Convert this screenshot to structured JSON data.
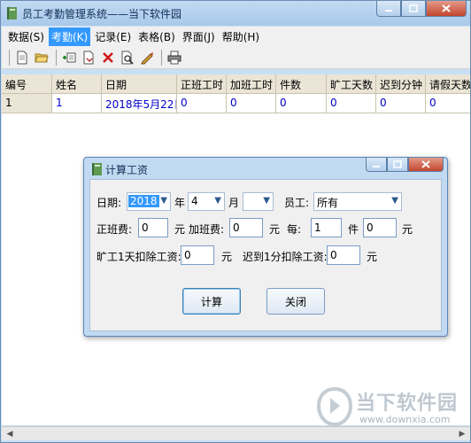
{
  "window": {
    "title": "员工考勤管理系统——当下软件园"
  },
  "menubar": {
    "items": [
      "数据(S)",
      "考勤(K)",
      "记录(E)",
      "表格(B)",
      "界面(J)",
      "帮助(H)"
    ],
    "active_index": 1
  },
  "toolbar": {
    "buttons": [
      "new-icon",
      "open-folder-icon",
      "add-record-icon",
      "export-icon",
      "delete-icon",
      "preview-icon",
      "edit-pencil-icon",
      "print-icon"
    ]
  },
  "grid": {
    "columns": [
      "编号",
      "姓名",
      "日期",
      "正班工时",
      "加班工时",
      "件数",
      "旷工天数",
      "迟到分钟",
      "请假天数"
    ],
    "rows": [
      [
        "1",
        "1",
        "2018年5月22日",
        "0",
        "0",
        "0",
        "0",
        "0",
        "0"
      ]
    ]
  },
  "dialog": {
    "title": "计算工资",
    "date_label": "日期:",
    "year_value": "2018",
    "year_unit": "年",
    "month_value": "4",
    "month_unit": "月",
    "day_value": "",
    "employee_label": "员工:",
    "employee_value": "所有",
    "base_pay_label": "正班费:",
    "base_pay_value": "0",
    "base_pay_unit": "元",
    "overtime_label": "加班费:",
    "overtime_value": "0",
    "overtime_unit": "元",
    "per_label": "每:",
    "per_value": "1",
    "per_unit": "件",
    "piece_value": "0",
    "piece_unit": "元",
    "absence_label": "旷工1天扣除工资:",
    "absence_value": "0",
    "absence_unit": "元",
    "late_label": "迟到1分扣除工资:",
    "late_value": "0",
    "late_unit": "元",
    "calc_button": "计算",
    "close_button": "关闭"
  },
  "watermark": {
    "text": "当下软件园",
    "url": "www.downxia.com"
  }
}
